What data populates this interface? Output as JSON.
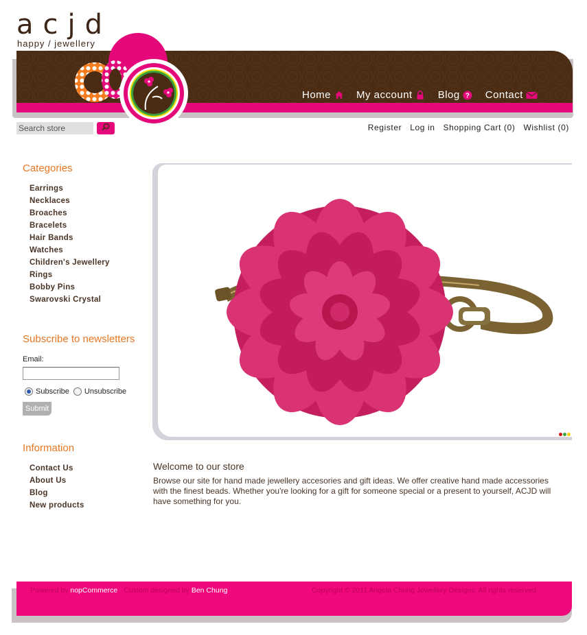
{
  "brand": {
    "name": "acjd",
    "tagline": "happy / jewellery"
  },
  "colors": {
    "accent": "#e5087a",
    "brown": "#4a2c14",
    "orange": "#e87722",
    "text": "#4a3426"
  },
  "nav": [
    {
      "label": "Home",
      "icon": "home-icon"
    },
    {
      "label": "My account",
      "icon": "lock-icon"
    },
    {
      "label": "Blog",
      "icon": "help-icon"
    },
    {
      "label": "Contact",
      "icon": "mail-icon"
    }
  ],
  "search": {
    "placeholder": "Search store",
    "value": "Search store",
    "icon": "search-icon"
  },
  "header_links": [
    "Register",
    "Log in",
    "Shopping Cart (0)",
    "Wishlist (0)"
  ],
  "categories": {
    "title": "Categories",
    "items": [
      "Earrings",
      "Necklaces",
      "Broaches",
      "Bracelets",
      "Hair Bands",
      "Watches",
      "Children's Jewellery",
      "Rings",
      "Bobby Pins",
      "Swarovski Crystal"
    ]
  },
  "newsletter": {
    "title": "Subscribe to newsletters",
    "email_label": "Email:",
    "email_value": "",
    "subscribe_label": "Subscribe",
    "unsubscribe_label": "Unsubscribe",
    "selected": "Subscribe",
    "submit_label": "Submit"
  },
  "information": {
    "title": "Information",
    "items": [
      "Contact Us",
      "About Us",
      "Blog",
      "New products"
    ]
  },
  "welcome": {
    "title": "Welcome to our store",
    "body": "Browse our site for hand made jewellery accesories and gift ideas. We offer creative hand made accessories with the finest beads. Whether you're looking for a gift for someone special or a present to yourself, ACJD will have something for you."
  },
  "slider": {
    "dot_colors": [
      "#d01010",
      "#3aa040",
      "#f0d000"
    ]
  },
  "footer": {
    "powered_by": "Powered by",
    "powered_link": "nopCommerce",
    "designed_by": "Custom designed by",
    "designer_link": "Ben Chung",
    "copyright": "Copyright © 2011 Angela Chung Jewellery Designs. All rights reserved."
  }
}
